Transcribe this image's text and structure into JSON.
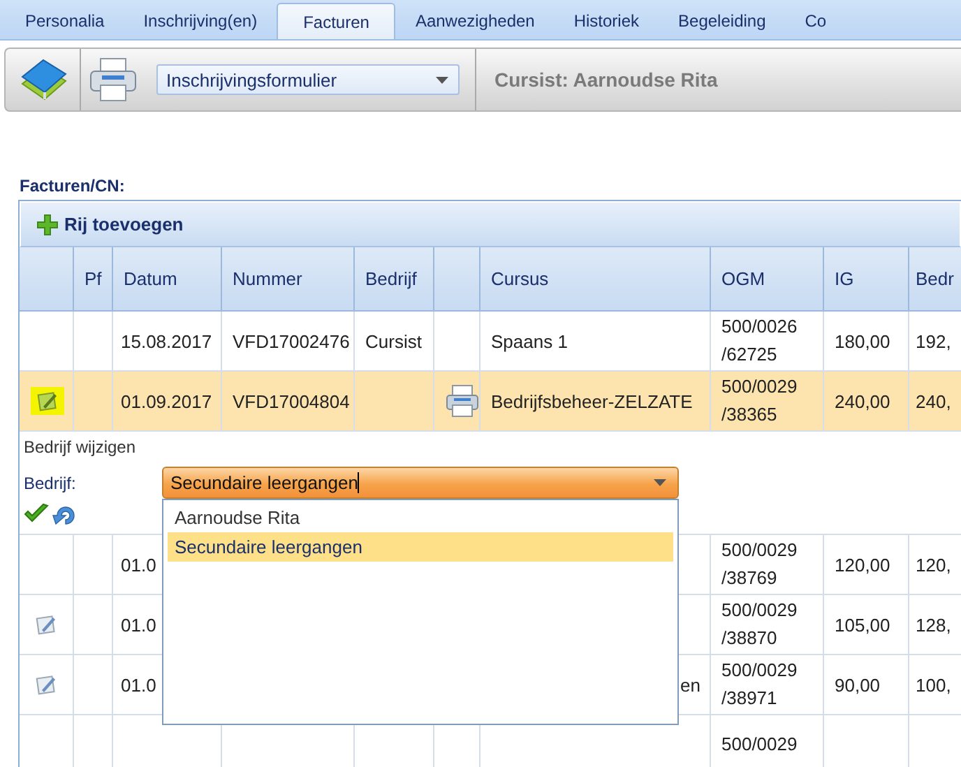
{
  "tabs": [
    {
      "label": "Personalia",
      "selected": false
    },
    {
      "label": "Inschrijving(en)",
      "selected": false
    },
    {
      "label": "Facturen",
      "selected": true
    },
    {
      "label": "Aanwezigheden",
      "selected": false
    },
    {
      "label": "Historiek",
      "selected": false
    },
    {
      "label": "Begeleiding",
      "selected": false
    },
    {
      "label": "Co",
      "selected": false
    }
  ],
  "toolbar": {
    "template_select": "Inschrijvingsformulier",
    "student_label": "Cursist: Aarnoudse Rita"
  },
  "section_title": "Facturen/CN:",
  "grid": {
    "add_row_label": "Rij toevoegen",
    "columns": [
      {
        "kind": "icon"
      },
      {
        "kind": "text",
        "label": "Pf"
      },
      {
        "kind": "text",
        "label": "Datum"
      },
      {
        "kind": "text",
        "label": "Nummer"
      },
      {
        "kind": "text",
        "label": "Bedrijf"
      },
      {
        "kind": "icon"
      },
      {
        "kind": "text",
        "label": "Cursus"
      },
      {
        "kind": "text",
        "label": "OGM"
      },
      {
        "kind": "text",
        "label": "IG"
      },
      {
        "kind": "text",
        "label": "Bedr"
      }
    ],
    "rows": [
      {
        "kind": "data",
        "selected": false,
        "edit": false,
        "print": false,
        "cells": [
          null,
          "15.08.2017",
          "VFD17002476",
          "Cursist",
          "Spaans 1",
          "500/0026 /62725",
          "180,00",
          "192,"
        ]
      },
      {
        "kind": "data",
        "selected": true,
        "edit": true,
        "print": true,
        "cells": [
          null,
          "01.09.2017",
          "VFD17004804",
          null,
          "Bedrijfsbeheer-ZELZATE",
          "500/0029 /38365",
          "240,00",
          "240,"
        ]
      },
      {
        "kind": "editor",
        "title": "Bedrijf wijzigen",
        "field_label": "Bedrijf:",
        "value": "Secundaire leergangen",
        "options": [
          {
            "label": "Aarnoudse Rita",
            "selected": false
          },
          {
            "label": "Secundaire leergangen",
            "selected": true
          }
        ]
      },
      {
        "kind": "data",
        "selected": false,
        "edit": false,
        "print": false,
        "cells": [
          null,
          "01.0",
          null,
          null,
          null,
          "500/0029 /38769",
          "120,00",
          "120,"
        ]
      },
      {
        "kind": "data",
        "selected": false,
        "edit": true,
        "print": false,
        "cells": [
          null,
          "01.0",
          null,
          null,
          null,
          "500/0029 /38870",
          "105,00",
          "128,"
        ]
      },
      {
        "kind": "data",
        "selected": false,
        "covered": true,
        "edit": true,
        "print": false,
        "cells": [
          null,
          "01.0",
          null,
          null,
          "en",
          "500/0029 /38971",
          "90,00",
          "100,"
        ]
      },
      {
        "kind": "data",
        "selected": false,
        "edit": false,
        "print": false,
        "cells": [
          null,
          null,
          null,
          null,
          null,
          "500/0029",
          null,
          null
        ]
      }
    ]
  }
}
